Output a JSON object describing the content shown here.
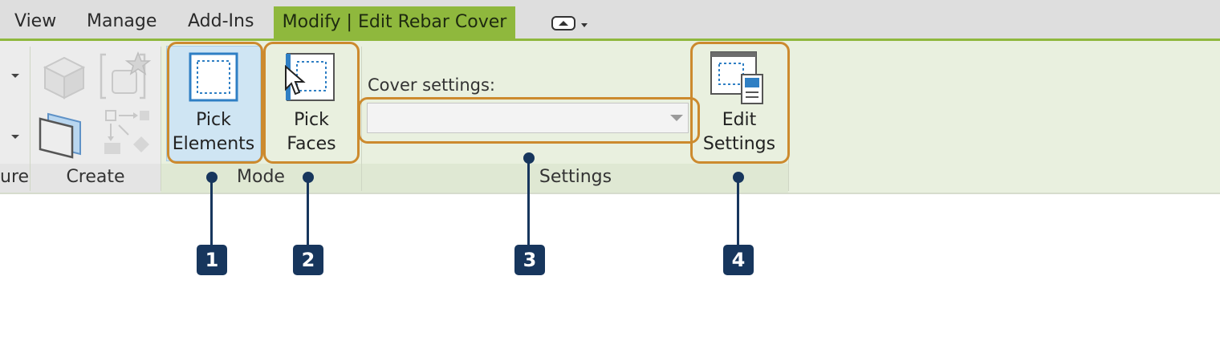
{
  "tabs": {
    "view": "View",
    "manage": "Manage",
    "add_ins": "Add-Ins",
    "active": "Modify | Edit Rebar Cover"
  },
  "ribbon": {
    "left_panel_label_partial": "ure",
    "create_panel_label": "Create",
    "mode_panel": {
      "label": "Mode",
      "pick_elements": {
        "line1": "Pick",
        "line2": "Elements"
      },
      "pick_faces": {
        "line1": "Pick",
        "line2": "Faces"
      }
    },
    "settings_panel": {
      "label": "Settings",
      "cover_settings_label": "Cover settings:",
      "cover_settings_value": "",
      "edit_settings": {
        "line1": "Edit",
        "line2": "Settings"
      }
    }
  },
  "callouts": [
    "1",
    "2",
    "3",
    "4"
  ],
  "colors": {
    "accent_green": "#8fb83d",
    "callout_orange": "#cc8a2e",
    "callout_navy": "#17365d"
  }
}
